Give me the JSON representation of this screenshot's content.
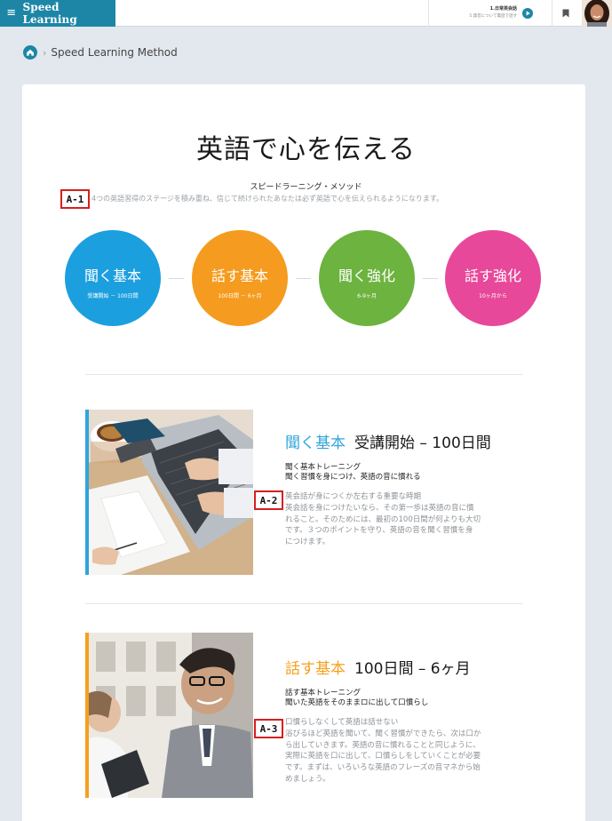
{
  "header": {
    "menu_glyph": "≡",
    "brand": "Speed Learning",
    "lesson_title": "1.日常英会話",
    "lesson_subtitle": "5.発音について電話で話す"
  },
  "breadcrumb": {
    "separator": "›",
    "current": "Speed Learning Method"
  },
  "hero": {
    "title": "英語で心を伝える",
    "method_label": "スピードラーニング・メソッド",
    "intro": "4つの英語習得のステージを積み重ね、信じて続けられたあなたは必ず英語で心を伝えられるようになります。"
  },
  "annotations": {
    "a1": "A-1",
    "a2": "A-2",
    "a3": "A-3"
  },
  "stages": [
    {
      "name": "聞く基本",
      "period": "受講開始 － 100日間",
      "color": "#1c9fde"
    },
    {
      "name": "話す基本",
      "period": "100日間 － 6ヶ月",
      "color": "#f59b1f"
    },
    {
      "name": "聞く強化",
      "period": "6-9ヶ月",
      "color": "#6db33f"
    },
    {
      "name": "話す強化",
      "period": "10ヶ月から",
      "color": "#e8489a"
    }
  ],
  "sections": [
    {
      "title_highlight": "聞く基本",
      "title_rest": "受講開始 – 100日間",
      "highlight_color": "#2fa5dd",
      "sub1": "聞く基本トレーニング",
      "sub2": "聞く習慣を身につけ、英語の音に慣れる",
      "body_lines": [
        "英会話が身につくか左右する重要な時期",
        "英会話を身につけたいなら、その第一歩は英語の音に慣",
        "れること。そのためには、最初の100日間が何よりも大切",
        "です。３つのポイントを守り、英語の音を聞く習慣を身",
        "につけます。"
      ]
    },
    {
      "title_highlight": "話す基本",
      "title_rest": "100日間 – 6ヶ月",
      "highlight_color": "#f5a01e",
      "sub1": "話す基本トレーニング",
      "sub2": "聞いた英語をそのままロに出して口慣らし",
      "body_lines": [
        "口慣らしなくして英語は話せない",
        "浴びるほど英語を聞いて、聞く習慣ができたら、次は口か",
        "ら出していきます。英語の音に慣れることと同じように、",
        "実際に英語を口に出して、口慣らしをしていくことが必要",
        "です。まずは、いろいろな英語のフレーズの音マネから始",
        "めましょう。"
      ]
    }
  ]
}
